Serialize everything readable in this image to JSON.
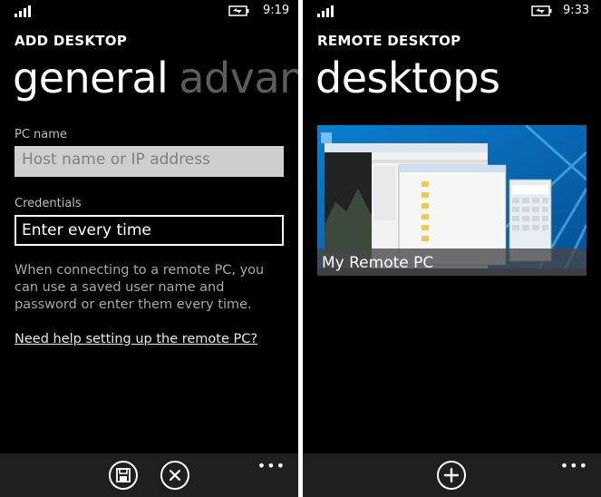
{
  "left": {
    "status": {
      "time": "9:19"
    },
    "app_title": "ADD DESKTOP",
    "pivot": {
      "active": "general",
      "next": "advanced"
    },
    "pc_name": {
      "label": "PC name",
      "placeholder": "Host name or IP address"
    },
    "credentials": {
      "label": "Credentials",
      "value": "Enter every time"
    },
    "help_text": "When connecting to a remote PC, you can use a saved user name and password or enter them every time.",
    "help_link": "Need help setting up the remote PC?",
    "appbar": {
      "buttons": [
        "save-icon",
        "cancel-icon"
      ],
      "more": "•••"
    }
  },
  "right": {
    "status": {
      "time": "9:33"
    },
    "app_title": "REMOTE DESKTOP",
    "pivot": {
      "active": "desktops"
    },
    "desktops": [
      {
        "name": "My Remote PC"
      }
    ],
    "appbar": {
      "buttons": [
        "add-icon"
      ],
      "more": "•••"
    }
  },
  "colors": {
    "accent_blue": "#0a6fb8",
    "appbar": "#1f1f1f",
    "inactive_pivot": "#5c5c5c"
  }
}
